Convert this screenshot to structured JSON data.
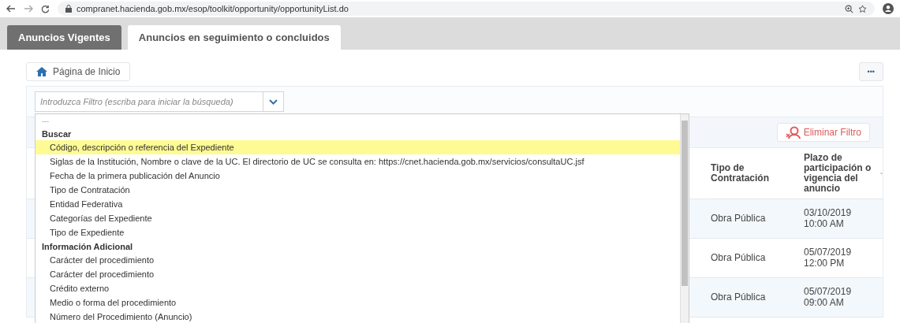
{
  "browser": {
    "url": "compranet.hacienda.gob.mx/esop/toolkit/opportunity/opportunityList.do"
  },
  "tabs": [
    {
      "label": "Anuncios Vigentes",
      "selected": false
    },
    {
      "label": "Anuncios en seguimiento o concluidos",
      "selected": true
    }
  ],
  "home_button": {
    "label": "Página de Inicio"
  },
  "more_button": {
    "label": "•••"
  },
  "filter": {
    "placeholder": "Introduzca Filtro (escriba para iniciar la búsqueda)",
    "dropdown_open": true
  },
  "dropdown": {
    "empty_option": "---",
    "groups": [
      {
        "label": "Buscar",
        "options": [
          {
            "label": "Código, descripción o referencia del Expediente",
            "selected": true
          },
          {
            "label": "Siglas de la Institución, Nombre o clave de la UC. El directorio de UC se consulta en: https://cnet.hacienda.gob.mx/servicios/consultaUC.jsf",
            "selected": false
          },
          {
            "label": "Fecha de la primera publicación del Anuncio",
            "selected": false
          },
          {
            "label": "Tipo de Contratación",
            "selected": false
          },
          {
            "label": "Entidad Federativa",
            "selected": false
          },
          {
            "label": "Categorías del Expediente",
            "selected": false
          },
          {
            "label": "Tipo de Expediente",
            "selected": false
          }
        ]
      },
      {
        "label": "Información Adicional",
        "options": [
          {
            "label": "Carácter del procedimiento",
            "selected": false
          },
          {
            "label": "Carácter del procedimiento",
            "selected": false
          },
          {
            "label": "Crédito externo",
            "selected": false
          },
          {
            "label": "Medio o forma del procedimiento",
            "selected": false
          },
          {
            "label": "Número del Procedimiento (Anuncio)",
            "selected": false
          }
        ]
      }
    ]
  },
  "clear_filter_button": {
    "label": "Eliminar Filtro"
  },
  "table": {
    "columns": [
      "Tipo de Contratación",
      "Plazo de participación o vigencia del anuncio"
    ],
    "rows": [
      {
        "cells": [
          "Obra Pública",
          "03/10/2019 10:00 AM"
        ]
      },
      {
        "cells": [
          "Obra Pública",
          "05/07/2019 12:00 PM"
        ]
      },
      {
        "cells": [
          "Obra Pública",
          "05/07/2019 09:00 AM"
        ]
      }
    ]
  }
}
